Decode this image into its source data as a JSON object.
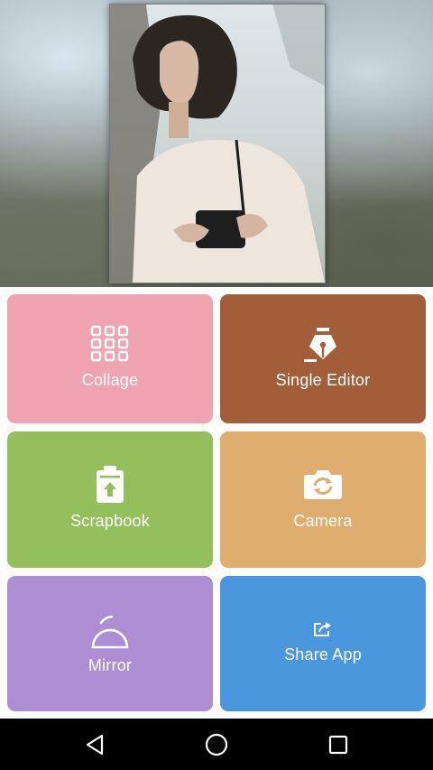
{
  "tiles": {
    "collage": {
      "label": "Collage",
      "icon": "grid-icon",
      "color": "#f0a4b1"
    },
    "single_editor": {
      "label": "Single Editor",
      "icon": "pen-nib-icon",
      "color": "#a25e38"
    },
    "scrapbook": {
      "label": "Scrapbook",
      "icon": "clipboard-upload-icon",
      "color": "#93bf5c"
    },
    "camera": {
      "label": "Camera",
      "icon": "camera-switch-icon",
      "color": "#dfae6e"
    },
    "mirror": {
      "label": "Mirror",
      "icon": "mirror-icon",
      "color": "#ae8ed2"
    },
    "share_app": {
      "label": "Share App",
      "icon": "share-icon",
      "color": "#4a97dd"
    }
  },
  "nav": {
    "back_icon": "back-icon",
    "home_icon": "home-icon",
    "recents_icon": "recents-icon"
  }
}
